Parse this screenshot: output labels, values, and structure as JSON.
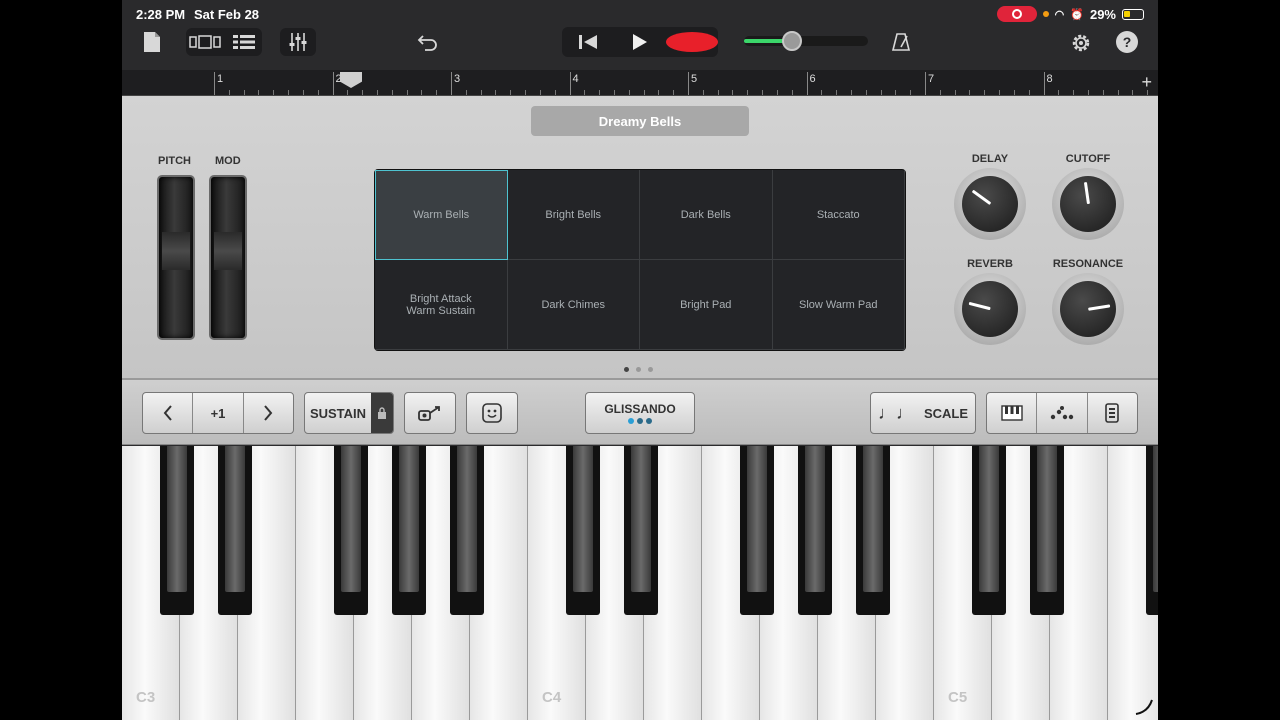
{
  "status": {
    "time": "2:28 PM",
    "date": "Sat Feb 28",
    "battery": "29%"
  },
  "ruler": {
    "bars": [
      "1",
      "2",
      "3",
      "4",
      "5",
      "6",
      "7",
      "8"
    ]
  },
  "patch": {
    "name": "Dreamy Bells"
  },
  "wheels": {
    "pitch_label": "PITCH",
    "mod_label": "MOD"
  },
  "presets": [
    {
      "label": "Warm Bells",
      "selected": true
    },
    {
      "label": "Bright Bells",
      "selected": false
    },
    {
      "label": "Dark Bells",
      "selected": false
    },
    {
      "label": "Staccato",
      "selected": false
    },
    {
      "label": "Bright Attack\nWarm Sustain",
      "selected": false
    },
    {
      "label": "Dark Chimes",
      "selected": false
    },
    {
      "label": "Bright Pad",
      "selected": false
    },
    {
      "label": "Slow Warm Pad",
      "selected": false
    }
  ],
  "pages": {
    "current": 1,
    "total": 3
  },
  "knobs": {
    "delay": {
      "label": "DELAY",
      "value": 0.3
    },
    "cutoff": {
      "label": "CUTOFF",
      "value": 0.47
    },
    "reverb": {
      "label": "REVERB",
      "value": 0.22
    },
    "resonance": {
      "label": "RESONANCE",
      "value": 0.8
    }
  },
  "controls": {
    "octave_value": "+1",
    "sustain_label": "SUSTAIN",
    "glissando_label": "GLISSANDO",
    "scale_label": "SCALE"
  },
  "volume": {
    "level": 0.38
  },
  "keyboard": {
    "octave_labels": [
      "C3",
      "C4",
      "C5"
    ]
  },
  "colors": {
    "record": "#e8202a",
    "volume": "#3bd66a",
    "selection": "#4ec3d0",
    "status_rec": "#e0243a"
  }
}
